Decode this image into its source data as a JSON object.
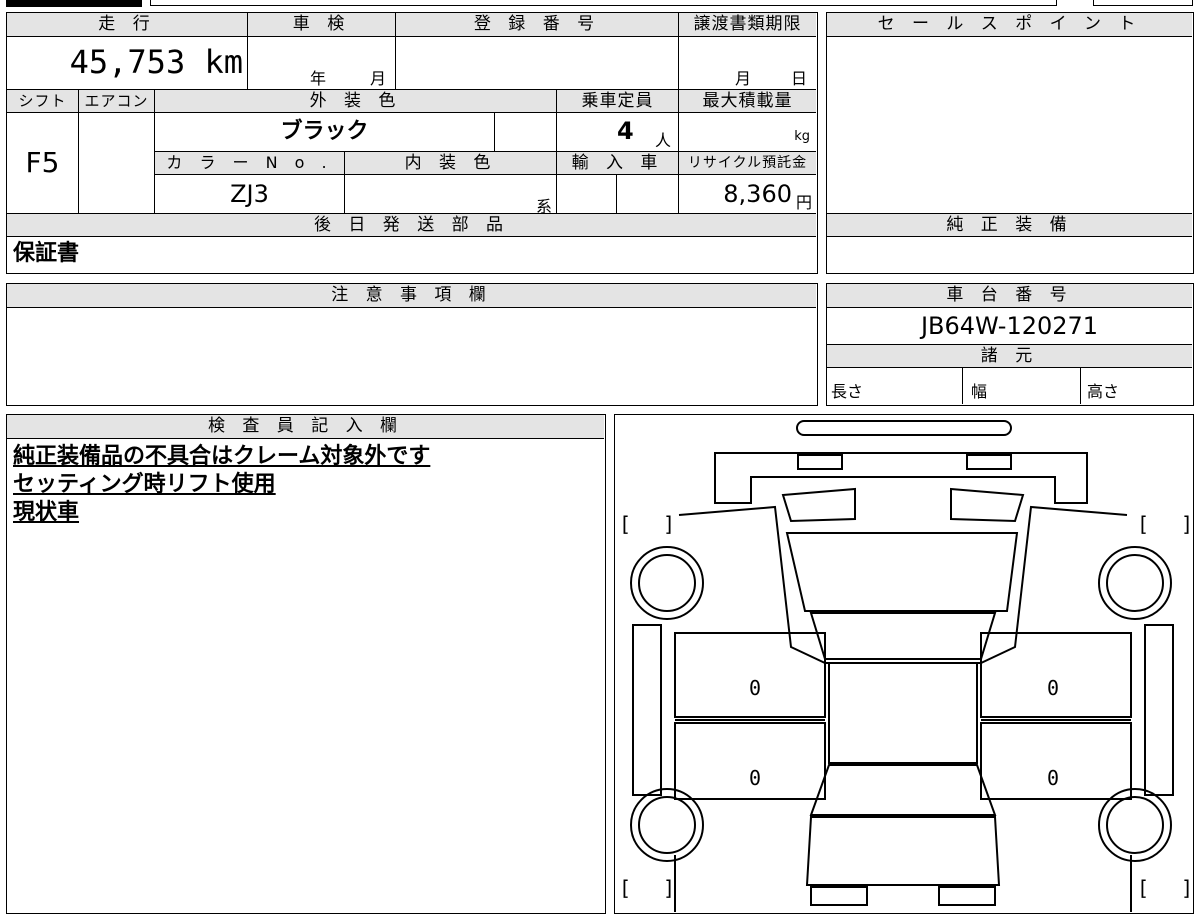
{
  "colors": {
    "header_bg": "#e4e4e4",
    "line": "#000000",
    "background": "#ffffff"
  },
  "sheet": {
    "mileage": {
      "label": "走 行",
      "value": "45,753 km"
    },
    "inspection": {
      "label": "車 検",
      "year_unit": "年",
      "month_unit": "月"
    },
    "registration": {
      "label": "登 録 番 号",
      "value": ""
    },
    "transfer_deadline": {
      "label": "譲渡書類期限",
      "month_unit": "月",
      "day_unit": "日"
    },
    "shift": {
      "label": "シフト",
      "value": "F5"
    },
    "aircon": {
      "label": "エアコン",
      "value": ""
    },
    "exterior_color": {
      "label": "外 装 色",
      "value": "ブラック"
    },
    "capacity": {
      "label": "乗車定員",
      "value": "4",
      "unit": "人"
    },
    "max_load": {
      "label": "最大積載量",
      "unit": "kg"
    },
    "color_no": {
      "label": "カ ラ ー N o .",
      "value": "ZJ3"
    },
    "interior_color": {
      "label": "内 装 色",
      "unit": "系"
    },
    "import": {
      "label": "輸 入 車"
    },
    "recycle_fee": {
      "label": "リサイクル預託金",
      "value": "8,360",
      "unit": "円"
    },
    "later_parts": {
      "label": "後 日 発 送 部 品",
      "value": "保証書"
    },
    "sales_points": {
      "label": "セ ー ル ス ポ イ ン ト"
    },
    "genuine_equipment": {
      "label": "純 正 装 備"
    },
    "caution": {
      "label": "注 意 事 項 欄"
    },
    "chassis_no": {
      "label": "車 台 番 号",
      "value": "JB64W-120271"
    },
    "specs": {
      "label": "諸 元",
      "length": "長さ",
      "width": "幅",
      "height": "高さ"
    },
    "inspector": {
      "label": "検 査 員 記 入 欄",
      "notes": [
        "純正装備品の不具合はクレーム対象外です",
        "セッティング時リフト使用",
        "現状車"
      ]
    },
    "diagram": {
      "door_marks": [
        "0",
        "0",
        "0",
        "0"
      ],
      "bracket_open": "[",
      "bracket_close": "]"
    }
  }
}
